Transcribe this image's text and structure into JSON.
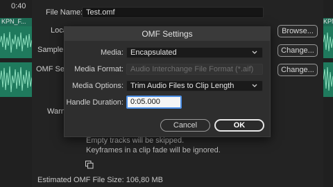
{
  "timeline": {
    "timecode": "0:40",
    "left_clip_name": "KPN_F...",
    "right_clip_name": "KPN"
  },
  "export_dialog": {
    "file_name_label": "File Name:",
    "file_name_value": "Test.omf",
    "location_label": "Locat",
    "sample_label": "Sample",
    "omf_settings_label": "OMF Setti",
    "warnings_label": "Warn",
    "browse_button": "Browse...",
    "change_button_1": "Change...",
    "change_button_2": "Change...",
    "notes": [
      "Empty tracks will be skipped.",
      "Keyframes in a clip fade will be ignored."
    ],
    "estimate": "Estimated OMF File Size: 106,80 MB"
  },
  "omf_settings": {
    "title": "OMF Settings",
    "media_label": "Media:",
    "media_value": "Encapsulated",
    "media_format_label": "Media Format:",
    "media_format_value": "Audio Interchange File Format (*.aif)",
    "media_options_label": "Media Options:",
    "media_options_value": "Trim Audio Files to Clip Length",
    "handle_duration_label": "Handle Duration:",
    "handle_duration_value": "0:05.000",
    "cancel_button": "Cancel",
    "ok_button": "OK"
  },
  "colors": {
    "clip_green": "#1f7a5d",
    "focus_blue": "#4c8fe6",
    "dialog_bg": "#2e2e2e"
  }
}
